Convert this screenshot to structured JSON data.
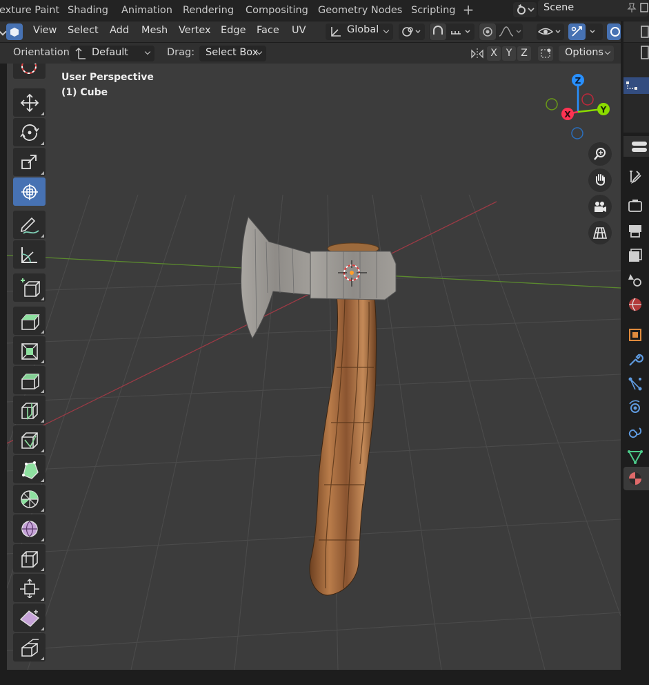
{
  "workspace_tabs": [
    "exture Paint",
    "Shading",
    "Animation",
    "Rendering",
    "Compositing",
    "Geometry Nodes",
    "Scripting"
  ],
  "add_workspace_label": "+",
  "scene": {
    "name": "Scene"
  },
  "header": {
    "menus": [
      "View",
      "Select",
      "Add",
      "Mesh",
      "Vertex",
      "Edge",
      "Face",
      "UV"
    ],
    "transform_orientation": "Global"
  },
  "tool_settings": {
    "orientation_label": "Orientation:",
    "orientation_value": "Default",
    "drag_label": "Drag:",
    "drag_value": "Select Box",
    "axes": [
      "X",
      "Y",
      "Z"
    ],
    "options_label": "Options"
  },
  "viewport": {
    "view_name": "User Perspective",
    "object_name": "(1) Cube",
    "gizmo_labels": {
      "z": "Z",
      "y": "Y",
      "x": "X"
    }
  },
  "toolbar_tools": [
    "cursor",
    "move",
    "rotate",
    "scale",
    "transform",
    "annotate",
    "measure",
    "add-cube",
    "extrude-region",
    "inset-faces",
    "bevel",
    "loop-cut",
    "knife",
    "poly-build",
    "spin",
    "smooth",
    "edge-slide",
    "shrink-fatten",
    "shear",
    "rip-region"
  ],
  "properties_tabs": [
    "tool",
    "render",
    "output",
    "view-layer",
    "scene",
    "world",
    "object",
    "modifiers",
    "particles",
    "physics",
    "constraints",
    "data",
    "material"
  ],
  "colors": {
    "accent": "#4772b3",
    "axis_x": "#ff3352",
    "axis_y": "#8bdc00",
    "axis_z": "#2890ff",
    "viewport_bg": "#3c3c3c",
    "header_bg": "#303030"
  }
}
